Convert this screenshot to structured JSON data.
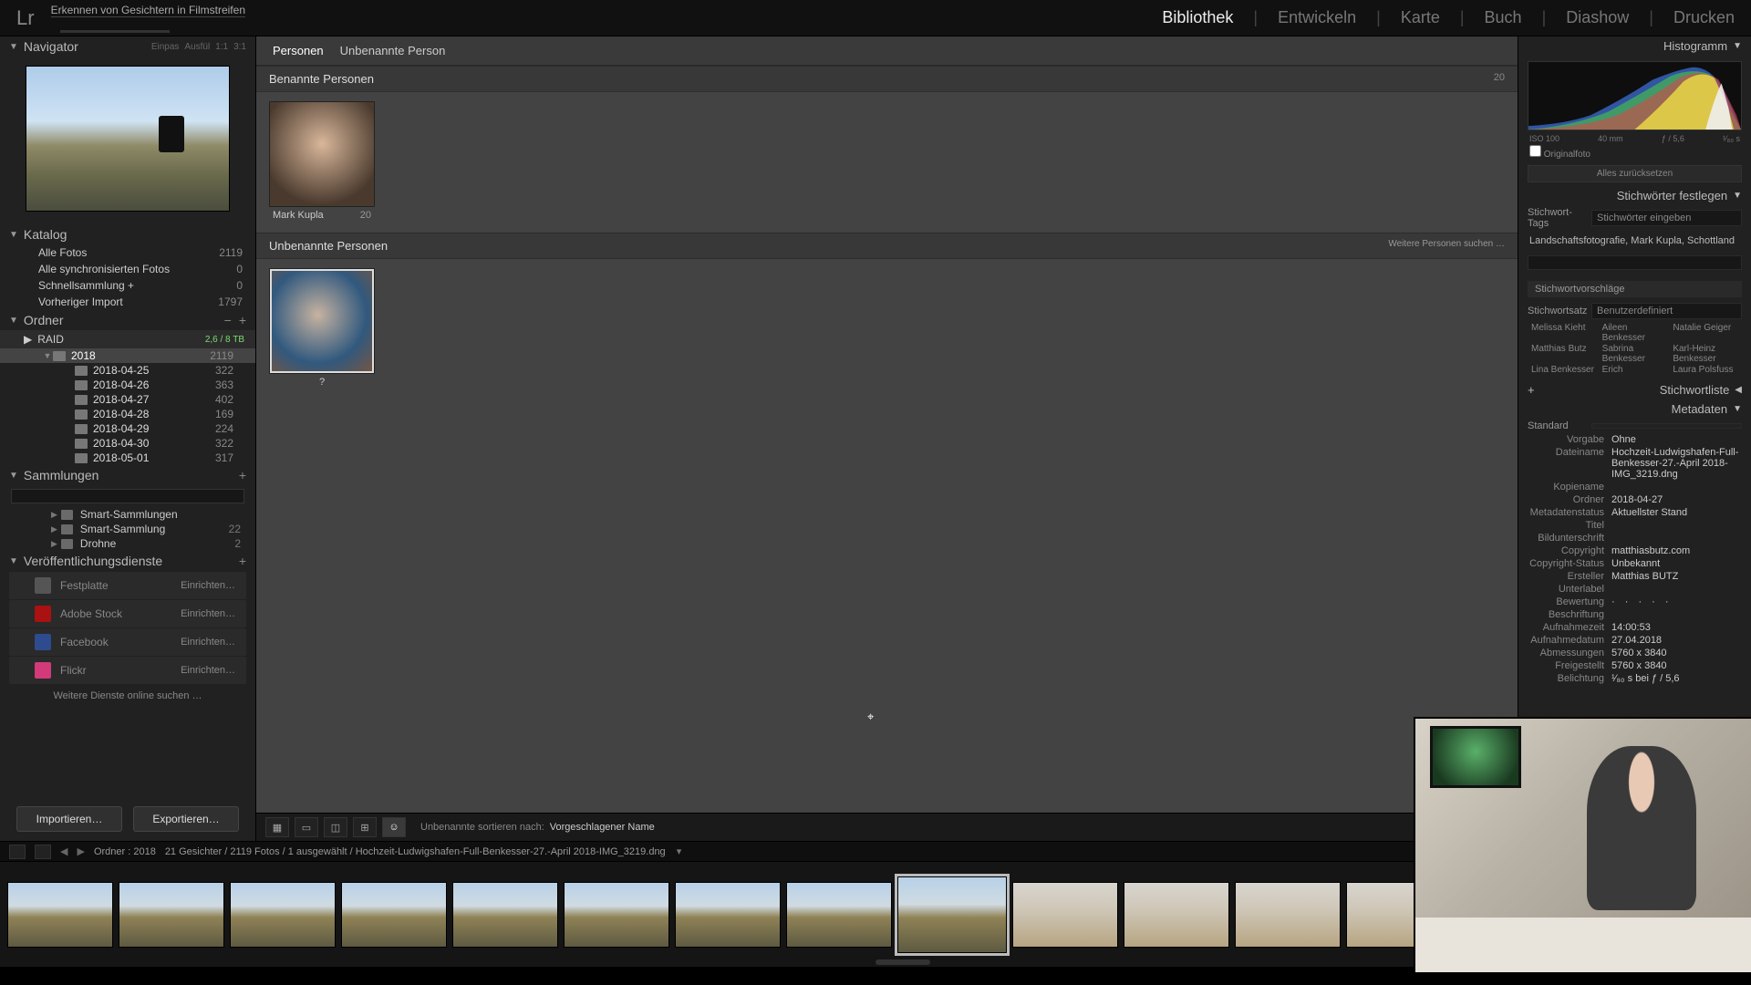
{
  "app": {
    "logo": "Lr",
    "task": "Erkennen von Gesichtern in Filmstreifen"
  },
  "modules": {
    "items": [
      "Bibliothek",
      "Entwickeln",
      "Karte",
      "Buch",
      "Diashow",
      "Drucken"
    ],
    "active": "Bibliothek"
  },
  "navigator": {
    "title": "Navigator",
    "zoom": [
      "Einpas",
      "Ausfül",
      "1:1",
      "3:1"
    ]
  },
  "katalog": {
    "title": "Katalog",
    "rows": [
      {
        "label": "Alle Fotos",
        "count": "2119"
      },
      {
        "label": "Alle synchronisierten Fotos",
        "count": "0"
      },
      {
        "label": "Schnellsammlung  +",
        "count": "0"
      },
      {
        "label": "Vorheriger Import",
        "count": "1797"
      }
    ]
  },
  "ordner": {
    "title": "Ordner",
    "volume": {
      "name": "RAID",
      "info": "2,6 / 8 TB"
    },
    "tree": [
      {
        "label": "2018",
        "count": "2119",
        "sel": true,
        "indent": 1,
        "open": true
      },
      {
        "label": "2018-04-25",
        "count": "322",
        "indent": 2
      },
      {
        "label": "2018-04-26",
        "count": "363",
        "indent": 2
      },
      {
        "label": "2018-04-27",
        "count": "402",
        "indent": 2
      },
      {
        "label": "2018-04-28",
        "count": "169",
        "indent": 2
      },
      {
        "label": "2018-04-29",
        "count": "224",
        "indent": 2
      },
      {
        "label": "2018-04-30",
        "count": "322",
        "indent": 2
      },
      {
        "label": "2018-05-01",
        "count": "317",
        "indent": 2
      }
    ]
  },
  "sammlungen": {
    "title": "Sammlungen",
    "rows": [
      {
        "label": "Smart-Sammlungen",
        "count": ""
      },
      {
        "label": "Smart-Sammlung",
        "count": "22"
      },
      {
        "label": "Drohne",
        "count": "2"
      }
    ]
  },
  "publish": {
    "title": "Veröffentlichungsdienste",
    "rows": [
      {
        "label": "Festplatte",
        "action": "Einrichten…",
        "color": "#555"
      },
      {
        "label": "Adobe Stock",
        "action": "Einrichten…",
        "color": "#a11"
      },
      {
        "label": "Facebook",
        "action": "Einrichten…",
        "color": "#2d4b8e"
      },
      {
        "label": "Flickr",
        "action": "Einrichten…",
        "color": "#d33a7a"
      }
    ],
    "more": "Weitere Dienste online suchen …"
  },
  "impex": {
    "import": "Importieren…",
    "export": "Exportieren…"
  },
  "breadcrumb": {
    "a": "Personen",
    "b": "Unbenannte Person"
  },
  "sections": {
    "named": {
      "title": "Benannte Personen",
      "count": "20"
    },
    "unnamed": {
      "title": "Unbenannte Personen",
      "more": "Weitere Personen suchen …"
    }
  },
  "faces": {
    "named": [
      {
        "name": "Mark Kupla",
        "count": "20"
      }
    ],
    "unnamed": [
      {
        "name": "?",
        "count": ""
      }
    ]
  },
  "centerTool": {
    "sortLabel": "Unbenannte sortieren nach:",
    "sortValue": "Vorgeschlagener Name"
  },
  "right": {
    "histogram": "Histogramm",
    "histInfo": {
      "iso": "ISO 100",
      "mm": "40 mm",
      "fstop": "ƒ / 5,6",
      "shutter": "¹⁄₈₀ s"
    },
    "original": "Originalfoto",
    "reset": "Alles zurücksetzen",
    "keywordsPanel": "Stichwörter festlegen",
    "kwTagsLabel": "Stichwort-Tags",
    "kwTagsValue": "Stichwörter eingeben",
    "kwText": "Landschaftsfotografie, Mark Kupla, Schottland",
    "suggTitle": "Stichwortvorschläge",
    "kwSetLabel": "Stichwortsatz",
    "kwSetValue": "Benutzerdefiniert",
    "sugg": [
      "Melissa Kieht",
      "Aileen Benkesser",
      "Natalie Geiger",
      "Matthias Butz",
      "Sabrina Benkesser",
      "Karl-Heinz Benkesser",
      "Lina Benkesser",
      "Erich",
      "Laura Polsfuss"
    ],
    "kwList": "Stichwortliste",
    "metaPanel": "Metadaten",
    "presetLabel": "Standard",
    "meta": [
      {
        "l": "Vorgabe",
        "v": "Ohne"
      },
      {
        "l": "Dateiname",
        "v": "Hochzeit-Ludwigshafen-Full-Benkesser-27.-April 2018-IMG_3219.dng"
      },
      {
        "l": "Kopiename",
        "v": ""
      },
      {
        "l": "Ordner",
        "v": "2018-04-27"
      },
      {
        "l": "Metadatenstatus",
        "v": "Aktuellster Stand"
      },
      {
        "l": "Titel",
        "v": ""
      },
      {
        "l": "Bildunterschrift",
        "v": ""
      },
      {
        "l": "Copyright",
        "v": "matthiasbutz.com"
      },
      {
        "l": "Copyright-Status",
        "v": "Unbekannt"
      },
      {
        "l": "Ersteller",
        "v": "Matthias BUTZ"
      },
      {
        "l": "Unterlabel",
        "v": ""
      },
      {
        "l": "Bewertung",
        "v": "· · · · ·"
      },
      {
        "l": "Beschriftung",
        "v": ""
      },
      {
        "l": "Aufnahmezeit",
        "v": "14:00:53"
      },
      {
        "l": "Aufnahmedatum",
        "v": "27.04.2018"
      },
      {
        "l": "Abmessungen",
        "v": "5760 x 3840"
      },
      {
        "l": "Freigestellt",
        "v": "5760 x 3840"
      },
      {
        "l": "Belichtung",
        "v": "¹⁄₈₀ s bei ƒ / 5,6"
      }
    ]
  },
  "pathbar": {
    "folder": "Ordner : 2018",
    "stats": "21 Gesichter / 2119 Fotos / 1 ausgewählt / Hochzeit-Ludwigshafen-Full-Benkesser-27.-April 2018-IMG_3219.dng"
  }
}
